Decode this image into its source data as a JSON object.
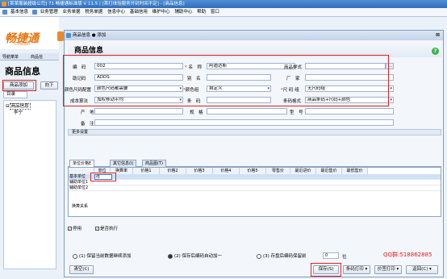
{
  "titlebar": {
    "text": "[某某服装超级公司] 71 畅捷通标准版 V 11.5 | [首打体验服务开封时间不定] - [商品信息]"
  },
  "menubar": {
    "items": [
      "基本信息",
      "业务管理",
      "业务单据",
      "税务单据",
      "信息中心",
      "基础信用",
      "维护中心",
      "辅助中心",
      "帮助",
      "窗口"
    ]
  },
  "logo": {
    "text": "畅捷通",
    "sub": "Chanjet"
  },
  "leftpane": {
    "tabs": [
      "导航菜单",
      "商品信"
    ],
    "title": "商品信息",
    "add_button": "商品添加",
    "next_button": "向下",
    "catalog_label": "目录",
    "tree": [
      "商品信息",
      "李宁"
    ]
  },
  "dialog": {
    "title": "商品信息 ● 添加",
    "close": "⊠",
    "header": "商品信息",
    "help": "?"
  },
  "form": {
    "code_label": "编　码",
    "code_value": "002",
    "name_label": "名　称",
    "name_value": "阿迪达斯",
    "image_label": "商品样式",
    "image_btn": "...",
    "mnemonic_label": "助记码",
    "mnemonic_value": "ADDS",
    "alias_label": "别　名",
    "alias_value": "",
    "maker_label": "厂　家",
    "maker_value": "",
    "color_cfg_label": "颜色尺码配置",
    "color_cfg_value": "颜色尺码都需要",
    "color_group_label": "颜色组",
    "color_group_value": "自定义",
    "size_group_label": "尺 码 组",
    "size_group_value": "无尺码组",
    "cost_label": "成本算法",
    "cost_value": "加权移动平均",
    "barcode_label": "条　码",
    "barcode_value": "",
    "barcode_fmt_label": "条码格式",
    "barcode_fmt_value": "商品条码+尺码+颜色",
    "origin_label": "产　地",
    "spec_label": "规　格",
    "model_label": "型　号",
    "remark_label": "备　注",
    "more_label": "更多设置"
  },
  "tabs": [
    "单位价格E",
    "其它信息(I)",
    "商品图(T)"
  ],
  "grid": {
    "headers": [
      "",
      "单位",
      "换算率",
      "价格1",
      "价格2",
      "价格3",
      "价格4",
      "价格5",
      "零售价",
      "最近进价",
      "最近售价",
      "最低售价"
    ],
    "rows": [
      "基本单位",
      "辅助单位1",
      "辅助单位2"
    ],
    "editing_value": "件",
    "footer": "换算关系"
  },
  "checks": {
    "stop_label": "停用",
    "stop_checked": true,
    "reject_label": "是否执行",
    "reject_checked": true
  },
  "options": {
    "opt1": "(1) 保留当前数据继续添加",
    "opt2": "(2) 保存后编码自动加一",
    "opt3": "(3) 存盘后编码保留前",
    "digits_value": "0",
    "digits_unit": "位"
  },
  "qq": "QQ群:518862885",
  "buttons": {
    "clear": "清空(C)",
    "save": "保存(S)",
    "barcode_print": "条码打印",
    "price_print": "价签打印",
    "back": "返回(C)"
  }
}
